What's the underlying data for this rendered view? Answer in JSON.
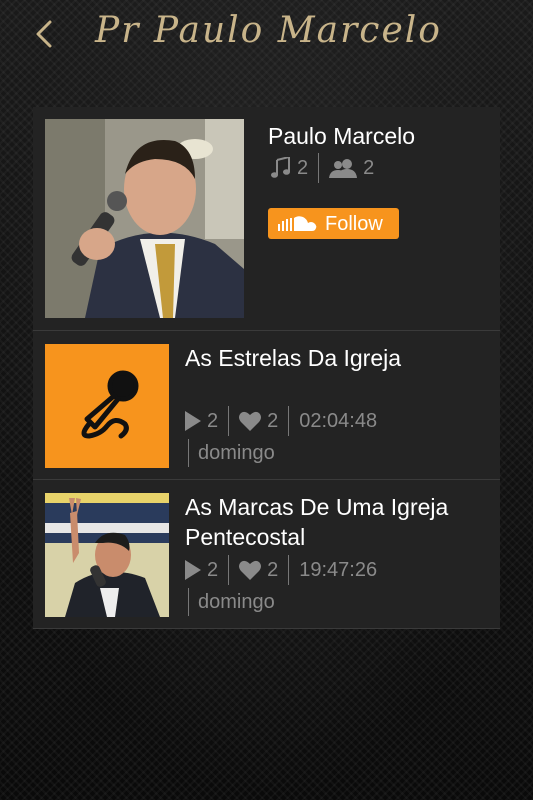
{
  "header": {
    "title": "Pr Paulo Marcelo"
  },
  "profile": {
    "name": "Paulo Marcelo",
    "tracks_count": "2",
    "followers_count": "2",
    "follow_label": "Follow"
  },
  "tracks": [
    {
      "title": "As Estrelas Da Igreja",
      "plays": "2",
      "likes": "2",
      "duration": "02:04:48",
      "date": "domingo"
    },
    {
      "title": "As Marcas De Uma Igreja Pentecostal",
      "plays": "2",
      "likes": "2",
      "duration": "19:47:26",
      "date": "domingo"
    }
  ],
  "colors": {
    "accent": "#f7941d",
    "title": "#c8b48a",
    "panel": "#232323",
    "muted": "#8a8a8a"
  }
}
